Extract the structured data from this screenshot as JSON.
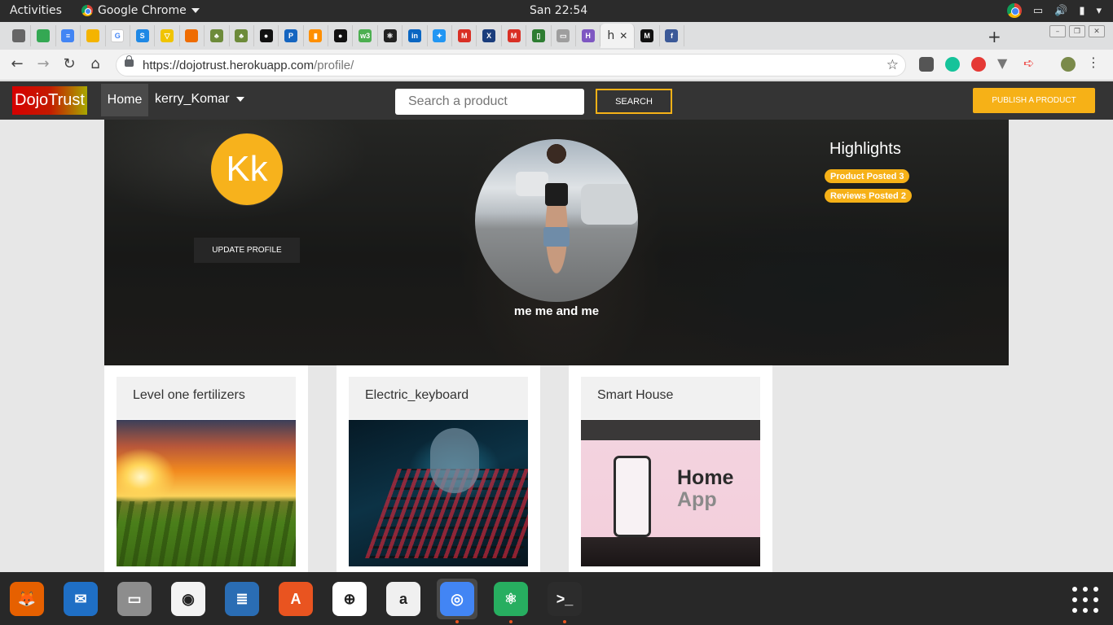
{
  "gnome": {
    "activities": "Activities",
    "app_name": "Google Chrome",
    "clock": "San 22:54"
  },
  "tabs": [
    {
      "icon": "book-icon",
      "letter": "",
      "color": "#666666"
    },
    {
      "icon": "google-drive-icon",
      "letter": "",
      "color": "#34a853"
    },
    {
      "icon": "google-docs-icon",
      "letter": "≡",
      "color": "#4285f4"
    },
    {
      "icon": "google-slides-icon",
      "letter": "",
      "color": "#f4b400"
    },
    {
      "icon": "google-icon",
      "letter": "G",
      "color": "#ffffff"
    },
    {
      "icon": "s-icon",
      "letter": "S",
      "color": "#1e88e5"
    },
    {
      "icon": "v-icon",
      "letter": "▽",
      "color": "#f0c400"
    },
    {
      "icon": "basketball-icon",
      "letter": "",
      "color": "#ef6c00"
    },
    {
      "icon": "tree-icon",
      "letter": "♣",
      "color": "#6d8b3a"
    },
    {
      "icon": "tree-icon",
      "letter": "♣",
      "color": "#6d8b3a"
    },
    {
      "icon": "github-icon",
      "letter": "●",
      "color": "#111111"
    },
    {
      "icon": "p-icon",
      "letter": "P",
      "color": "#1565c0"
    },
    {
      "icon": "chart-icon",
      "letter": "▮",
      "color": "#ff8f00"
    },
    {
      "icon": "github-icon",
      "letter": "●",
      "color": "#111111"
    },
    {
      "icon": "w3-icon",
      "letter": "w3",
      "color": "#4caf50"
    },
    {
      "icon": "react-icon",
      "letter": "⚛",
      "color": "#222222"
    },
    {
      "icon": "linkedin-icon",
      "letter": "in",
      "color": "#0a66c2"
    },
    {
      "icon": "bulb-icon",
      "letter": "✦",
      "color": "#2196f3"
    },
    {
      "icon": "gmail-icon",
      "letter": "M",
      "color": "#d93025"
    },
    {
      "icon": "x-icon",
      "letter": "X",
      "color": "#1a3d7c"
    },
    {
      "icon": "gmail-icon",
      "letter": "M",
      "color": "#d93025"
    },
    {
      "icon": "phone-icon",
      "letter": "▯",
      "color": "#2e7d32"
    },
    {
      "icon": "document-icon",
      "letter": "▭",
      "color": "#9e9e9e"
    },
    {
      "icon": "h-icon",
      "letter": "H",
      "color": "#7e57c2"
    },
    {
      "icon": "medium-icon",
      "letter": "M",
      "color": "#111111"
    },
    {
      "icon": "facebook-icon",
      "letter": "f",
      "color": "#3b5998"
    }
  ],
  "active_tab": {
    "label": "h",
    "close": "✕"
  },
  "new_tab": "+",
  "omnibox": {
    "url_host": "https://dojotrust.herokuapp.com",
    "url_path": "/profile/"
  },
  "site": {
    "brand": "DojoTrust",
    "home": "Home",
    "username": "kerry_Komar",
    "search_placeholder": "Search a product",
    "search_button": "SEARCH",
    "publish_button": "PUBLISH A PRODUCT"
  },
  "profile": {
    "initials": "Kk",
    "update_button": "UPDATE PROFILE",
    "caption": "me me and me",
    "highlights_title": "Highlights",
    "badges": [
      "Product Posted 3",
      "Reviews Posted 2"
    ]
  },
  "products": [
    {
      "title": "Level one fertilizers",
      "image": "field-sunset"
    },
    {
      "title": "Electric_keyboard",
      "image": "keyboard"
    },
    {
      "title": "Smart House",
      "image": "home-app",
      "image_text": [
        "Home",
        "App"
      ]
    }
  ],
  "dock": [
    {
      "name": "firefox",
      "color": "#e66000",
      "glyph": "🦊"
    },
    {
      "name": "thunderbird",
      "color": "#1f6fc5",
      "glyph": "✉"
    },
    {
      "name": "files",
      "color": "#8d8d8d",
      "glyph": "▭"
    },
    {
      "name": "rhythmbox",
      "color": "#f3f3f3",
      "glyph": "◉"
    },
    {
      "name": "libreoffice-writer",
      "color": "#2a6db4",
      "glyph": "≣"
    },
    {
      "name": "software-center",
      "color": "#e95420",
      "glyph": "A"
    },
    {
      "name": "help",
      "color": "#ffffff",
      "glyph": "⊕"
    },
    {
      "name": "amazon",
      "color": "#f0f0f0",
      "glyph": "a"
    },
    {
      "name": "chrome",
      "color": "#4285f4",
      "glyph": "◎"
    },
    {
      "name": "atom",
      "color": "#27ae60",
      "glyph": "⚛"
    },
    {
      "name": "terminal",
      "color": "#2c2c2c",
      "glyph": ">_"
    }
  ]
}
